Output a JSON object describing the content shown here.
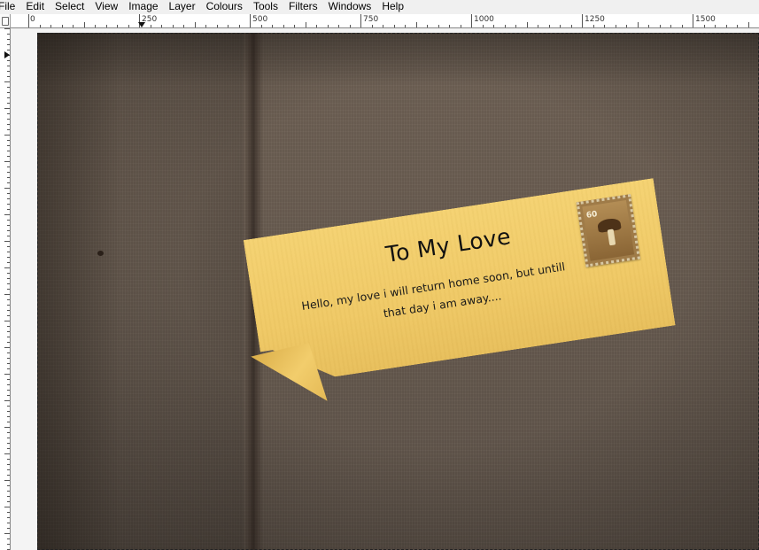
{
  "menu": {
    "items": [
      {
        "label": "File"
      },
      {
        "label": "Edit"
      },
      {
        "label": "Select"
      },
      {
        "label": "View"
      },
      {
        "label": "Image"
      },
      {
        "label": "Layer"
      },
      {
        "label": "Colours"
      },
      {
        "label": "Tools"
      },
      {
        "label": "Filters"
      },
      {
        "label": "Windows"
      },
      {
        "label": "Help"
      }
    ]
  },
  "ruler": {
    "labels": [
      "0",
      "250",
      "500",
      "750",
      "1000",
      "1250",
      "1500"
    ]
  },
  "note": {
    "title": "To My Love",
    "line1": "Hello, my love i will return home soon, but untill",
    "line2": "that day i am away....",
    "stamp_value": "60"
  },
  "colors": {
    "background": "#665a4f",
    "note_paper": "#f0c965",
    "text": "#111111"
  }
}
